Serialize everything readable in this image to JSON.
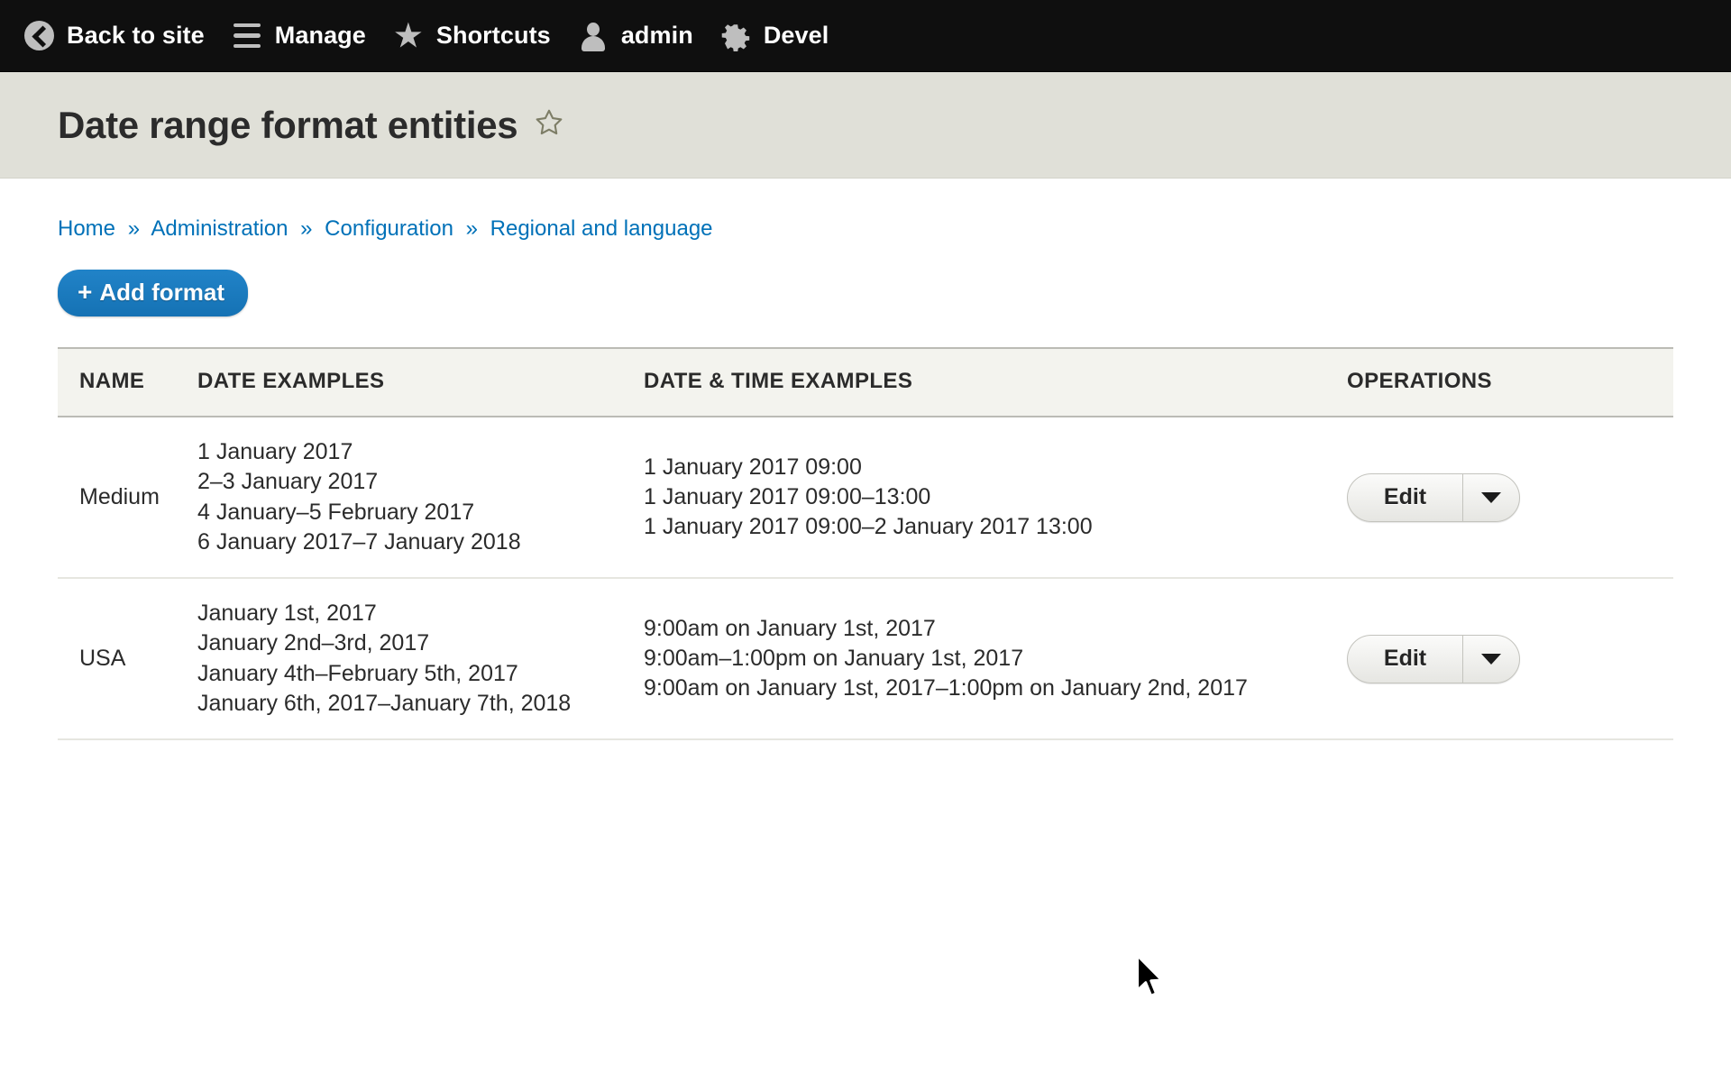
{
  "toolbar": {
    "items": [
      {
        "label": "Back to site",
        "icon": "back-circle-icon"
      },
      {
        "label": "Manage",
        "icon": "hamburger-icon"
      },
      {
        "label": "Shortcuts",
        "icon": "star-icon"
      },
      {
        "label": "admin",
        "icon": "person-icon"
      },
      {
        "label": "Devel",
        "icon": "gear-icon"
      }
    ]
  },
  "header": {
    "title": "Date range format entities",
    "favorite_icon": "star-outline-icon"
  },
  "breadcrumb": {
    "separator": "»",
    "items": [
      "Home",
      "Administration",
      "Configuration",
      "Regional and language"
    ]
  },
  "actions": {
    "add_format_plus": "+",
    "add_format_label": "Add format"
  },
  "table": {
    "columns": [
      "NAME",
      "DATE EXAMPLES",
      "DATE & TIME EXAMPLES",
      "OPERATIONS"
    ],
    "rows": [
      {
        "name": "Medium",
        "date_examples": [
          "1 January 2017",
          "2–3 January 2017",
          "4 January–5 February 2017",
          "6 January 2017–7 January 2018"
        ],
        "datetime_examples": [
          "1 January 2017 09:00",
          "1 January 2017 09:00–13:00",
          "1 January 2017 09:00–2 January 2017 13:00"
        ],
        "operation_label": "Edit",
        "operation_toggle_icon": "chevron-down-icon"
      },
      {
        "name": "USA",
        "date_examples": [
          "January 1st, 2017",
          "January 2nd–3rd, 2017",
          "January 4th–February 5th, 2017",
          "January 6th, 2017–January 7th, 2018"
        ],
        "datetime_examples": [
          "9:00am on January 1st, 2017",
          "9:00am–1:00pm on January 1st, 2017",
          "9:00am on January 1st, 2017–1:00pm on January 2nd, 2017"
        ],
        "operation_label": "Edit",
        "operation_toggle_icon": "chevron-down-icon"
      }
    ]
  },
  "colors": {
    "toolbar_bg": "#0f0f0f",
    "title_band_bg": "#e0e0d8",
    "link_blue": "#0071b8",
    "button_blue": "#1976ba",
    "table_header_bg": "#f3f3ee",
    "text": "#2b2b2b"
  }
}
